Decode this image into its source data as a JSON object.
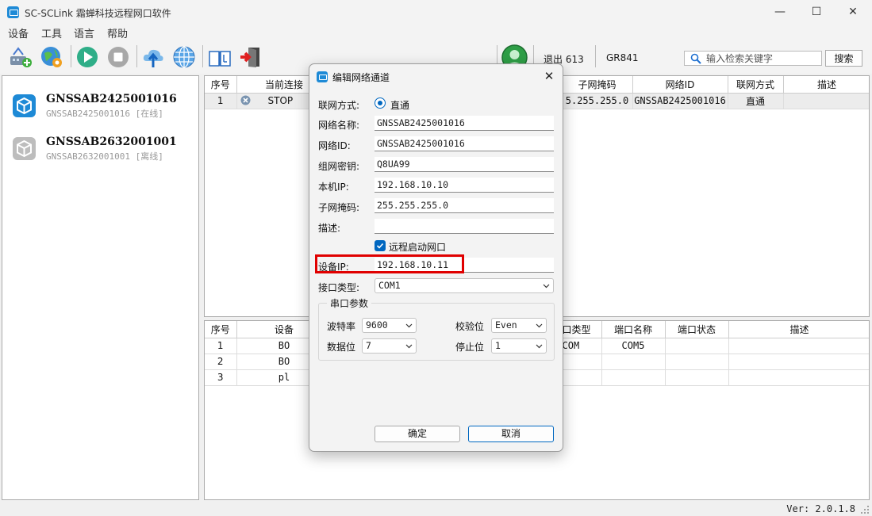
{
  "window": {
    "title": "SC-SCLink 霜蝉科技远程网口软件",
    "controls": {
      "minimize": "—",
      "maximize": "☐",
      "close": "✕"
    }
  },
  "menu": [
    "设备",
    "工具",
    "语言",
    "帮助"
  ],
  "toolbar": {
    "icons": [
      "add-device-icon",
      "globe-settings-icon",
      "play-icon",
      "stop-icon",
      "upload-cloud-icon",
      "internet-globe-icon",
      "manual-book-icon",
      "exit-door-icon",
      "user-avatar-icon"
    ],
    "exit_label": "退出 613",
    "device_label": "GR841",
    "search_placeholder": "输入检索关键字",
    "search_button": "搜索"
  },
  "devices": [
    {
      "name": "GNSSAB2425001016",
      "subtitle": "GNSSAB2425001016 [在线]",
      "status": "online",
      "color": "#1e8ad6"
    },
    {
      "name": "GNSSAB2632001001",
      "subtitle": "GNSSAB2632001001 [离线]",
      "status": "offline",
      "color": "#b8b8b8"
    }
  ],
  "upper_table": {
    "columns": [
      "序号",
      "当前连接",
      "",
      "",
      "子网掩码",
      "网络ID",
      "联网方式",
      "描述"
    ],
    "rows": [
      {
        "index": "1",
        "connection": "STOP",
        "hidden1": "",
        "hidden2": "",
        "mask": "5.255.255.0",
        "network_id": "GNSSAB2425001016",
        "mode": "直通",
        "desc": ""
      }
    ]
  },
  "lower_table": {
    "columns": [
      "序号",
      "设备",
      "",
      "",
      "口类型",
      "端口名称",
      "端口状态",
      "描述"
    ],
    "rows": [
      {
        "index": "1",
        "device": "BO",
        "port_type": "COM",
        "port_name": "COM5",
        "port_status": "",
        "desc": ""
      },
      {
        "index": "2",
        "device": "BO",
        "port_type": "",
        "port_name": "",
        "port_status": "",
        "desc": ""
      },
      {
        "index": "3",
        "device": "pl",
        "port_type": "",
        "port_name": "",
        "port_status": "",
        "desc": ""
      }
    ]
  },
  "status_bar": {
    "version": "Ver: 2.0.1.8"
  },
  "dialog": {
    "title": "编辑网络通道",
    "close": "✕",
    "fields": {
      "mode_label": "联网方式:",
      "mode_value": "直通",
      "network_name_label": "网络名称:",
      "network_name": "GNSSAB2425001016",
      "network_id_label": "网络ID:",
      "network_id": "GNSSAB2425001016",
      "password_label": "组网密钥:",
      "password": "Q8UA99",
      "local_ip_label": "本机IP:",
      "local_ip": "192.168.10.10",
      "mask_label": "子网掩码:",
      "mask": "255.255.255.0",
      "desc_label": "描述:",
      "desc": "",
      "remote_start_label": "远程启动网口",
      "remote_start_checked": true,
      "device_ip_label": "设备IP:",
      "device_ip": "192.168.10.11",
      "interface_label": "接口类型:",
      "interface": "COM1"
    },
    "serial": {
      "title": "串口参数",
      "baud_label": "波特率",
      "baud": "9600",
      "parity_label": "校验位",
      "parity": "Even",
      "data_bits_label": "数据位",
      "data_bits": "7",
      "stop_bits_label": "停止位",
      "stop_bits": "1"
    },
    "ok": "确定",
    "cancel": "取消"
  }
}
